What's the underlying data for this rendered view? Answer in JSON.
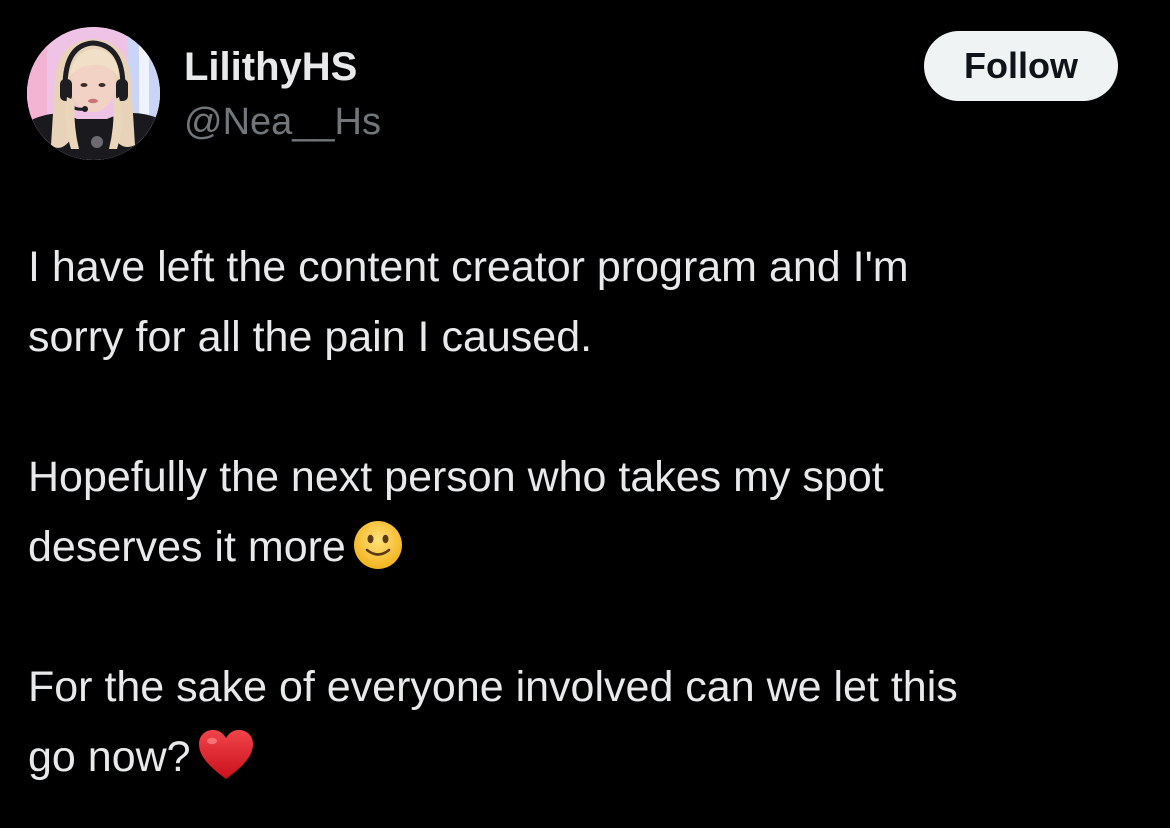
{
  "author": {
    "display_name": "LilithyHS",
    "handle": "@Nea__Hs",
    "avatar_icon": "avatar-photo"
  },
  "follow_button": {
    "label": "Follow"
  },
  "tweet": {
    "lines": [
      "I have left the content creator program and I'm",
      "sorry for all the pain I caused.",
      "Hopefully the next person who takes my spot",
      "deserves it more",
      "For the sake of everyone involved can we let this",
      "go now?"
    ],
    "emojis": [
      "slightly-smiling-face-icon",
      "red-heart-icon"
    ]
  },
  "colors": {
    "background": "#000000",
    "text_primary": "#e7e9ea",
    "text_secondary": "#71767b",
    "button_bg": "#eff3f4",
    "button_text": "#0f1419",
    "heart": "#e0202b",
    "smiley": "#f9c935"
  }
}
